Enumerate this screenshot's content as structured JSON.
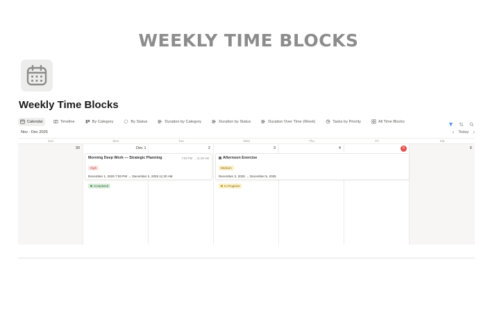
{
  "banner": "WEEKLY TIME BLOCKS",
  "icon": "calendar-icon",
  "page_title": "Weekly Time Blocks",
  "tabs": [
    {
      "label": "Calendar",
      "icon": "calendar-icon",
      "active": true
    },
    {
      "label": "Timeline",
      "icon": "timeline-icon"
    },
    {
      "label": "By Category",
      "icon": "board-icon"
    },
    {
      "label": "By Status",
      "icon": "status-icon"
    },
    {
      "label": "Duration by Category",
      "icon": "bar-chart-icon"
    },
    {
      "label": "Duration by Status",
      "icon": "bar-chart-icon"
    },
    {
      "label": "Duration Over Time (Week)",
      "icon": "bar-chart-icon"
    },
    {
      "label": "Tasks by Priority",
      "icon": "pie-chart-icon"
    },
    {
      "label": "All Time Blocks",
      "icon": "gallery-icon"
    }
  ],
  "tools": [
    "filter-icon",
    "sort-icon",
    "search-icon"
  ],
  "calendar": {
    "range": "Nov - Dec 2025",
    "today_label": "Today",
    "weekdays": [
      "Sun",
      "Mon",
      "Tue",
      "Wed",
      "Thu",
      "Fri",
      "Sat"
    ],
    "days": [
      "30",
      "Dec 1",
      "2",
      "3",
      "4",
      "5",
      "6"
    ],
    "today_index": 5,
    "events": [
      {
        "title": "Morning Deep Work — Strategic Planning",
        "time": "7:00 PM → 11:30 AM",
        "priority": "High",
        "range": "December 1, 2025 7:00 PM → December 2, 2025 11:30 AM",
        "status": "Completed"
      },
      {
        "title": "Afternoon Exercise",
        "priority": "Medium",
        "range": "December 3, 2025 → December 5, 2025",
        "status": "In Progress"
      }
    ]
  },
  "colors": {
    "accent": "#e4504b",
    "weekend_bg": "#f7f6f4",
    "completed_dot": "#4f9a5f",
    "progress_dot": "#c29a1c",
    "filter_icon": "#2f80ed"
  }
}
